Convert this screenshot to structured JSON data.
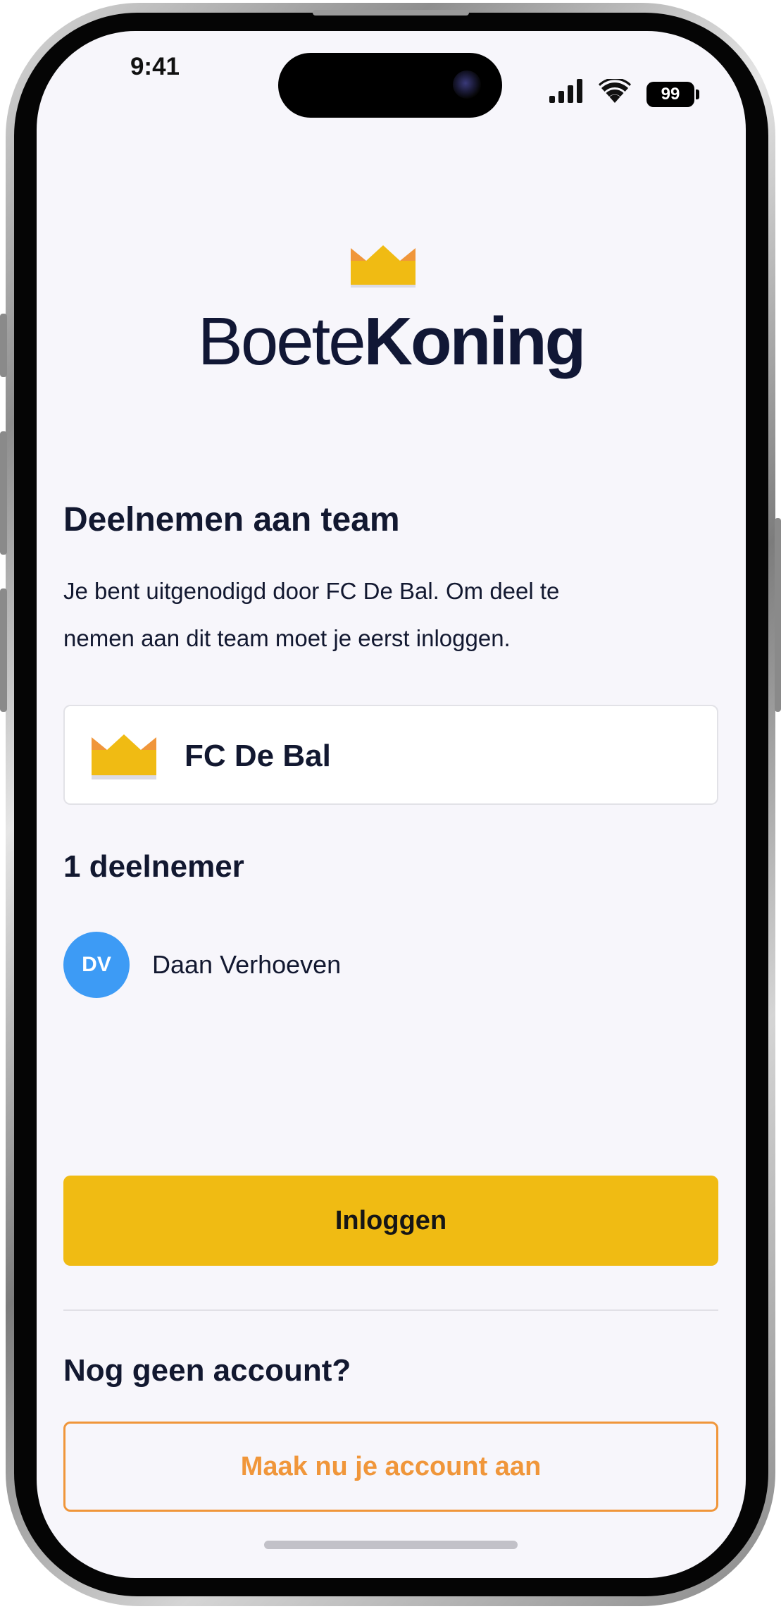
{
  "status_bar": {
    "time": "9:41",
    "battery": "99",
    "icons": [
      "signal-icon",
      "wifi-icon",
      "battery-icon"
    ]
  },
  "logo": {
    "part1": "Boete",
    "part2": "Koning",
    "icon": "crown-icon"
  },
  "join": {
    "title": "Deelnemen aan team",
    "line1": "Je bent uitgenodigd door FC De Bal. Om deel te",
    "line2": "nemen aan dit team moet je eerst inloggen."
  },
  "team": {
    "name": "FC De Bal",
    "icon": "crown-icon"
  },
  "participants": {
    "heading": "1 deelnemer",
    "members": [
      {
        "initials": "DV",
        "name": "Daan Verhoeven",
        "avatar_color": "#3d9bf5"
      }
    ]
  },
  "actions": {
    "login_label": "Inloggen",
    "no_account": "Nog geen account?",
    "create_label": "Maak nu je account aan"
  },
  "colors": {
    "primary": "#f0bb13",
    "accent": "#f0963a",
    "text": "#121830",
    "crown_orange": "#f0963a",
    "crown_yellow": "#f0bb13"
  }
}
